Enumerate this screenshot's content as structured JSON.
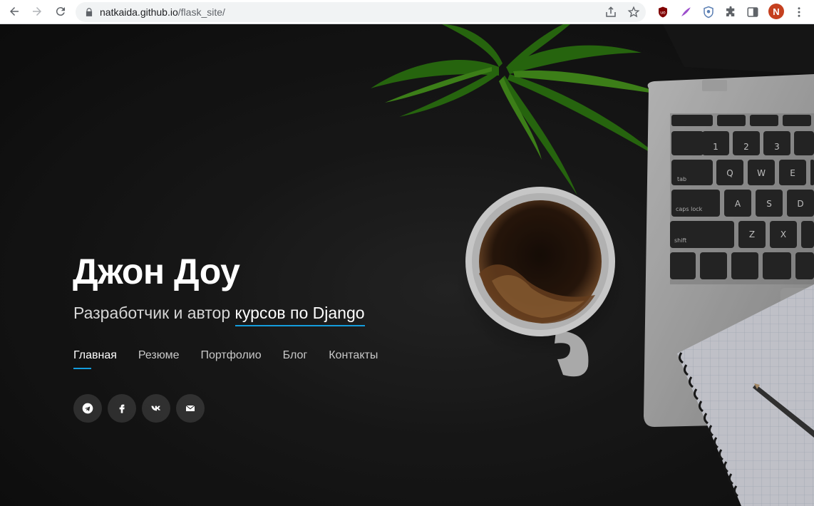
{
  "browser": {
    "url_host": "natkaida.github.io",
    "url_path": "/flask_site/",
    "profile_initial": "N",
    "colors": {
      "avatar": "#c5401f",
      "accent": "#149ddd"
    },
    "icons": [
      "back-icon",
      "forward-icon",
      "reload-icon",
      "lock-icon",
      "share-icon",
      "bookmark-star-icon",
      "ublock-icon",
      "quill-extension-icon",
      "shield-extension-icon",
      "extensions-puzzle-icon",
      "side-panel-icon",
      "menu-dots-icon"
    ]
  },
  "hero": {
    "title": "Джон Доу",
    "subtitle_static": "Разработчик и автор ",
    "subtitle_typed": "курсов по Django",
    "menu": [
      {
        "label": "Главная",
        "active": true
      },
      {
        "label": "Резюме",
        "active": false
      },
      {
        "label": "Портфолио",
        "active": false
      },
      {
        "label": "Блог",
        "active": false
      },
      {
        "label": "Контакты",
        "active": false
      }
    ],
    "socials": [
      "telegram-icon",
      "facebook-icon",
      "vk-icon",
      "email-icon"
    ]
  }
}
